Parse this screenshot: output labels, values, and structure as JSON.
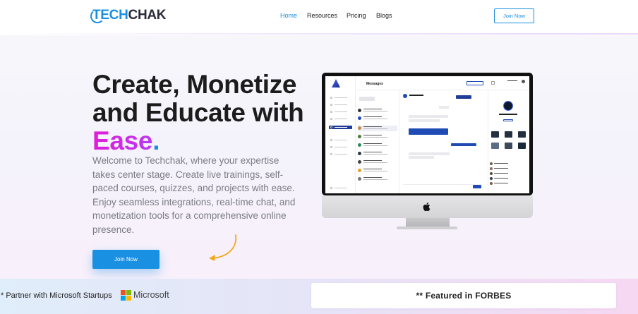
{
  "brand": {
    "part1": "TECH",
    "part2": "CHAK"
  },
  "nav": {
    "links": [
      {
        "label": "Home",
        "active": true
      },
      {
        "label": "Resources",
        "active": false
      },
      {
        "label": "Pricing",
        "active": false
      },
      {
        "label": "Blogs",
        "active": false
      }
    ],
    "join_label": "Join Now"
  },
  "hero": {
    "headline_line1": "Create, Monetize",
    "headline_line2": "and Educate with",
    "headline_ease": "Ease",
    "headline_dot": ".",
    "subtext": "Welcome to Techchak, where your expertise takes center stage. Create live trainings, self-paced courses, quizzes, and projects with ease. Enjoy seamless integrations, real-time chat, and monetization tools for a comprehensive online presence.",
    "join_label": "Join Now"
  },
  "screen": {
    "title": "Messages"
  },
  "partners": {
    "microsoft_text": "* Partner with Microsoft Startups",
    "microsoft_logo_text": "Microsoft",
    "featured_text": "** Featured in FORBES"
  },
  "colors": {
    "accent": "#1a8fe0",
    "ease_gradient_start": "#e01cdb",
    "ease_gradient_end": "#b93af0",
    "dark_text": "#1c1c1c",
    "muted_text": "#7b7b85"
  },
  "icons": [
    "techchak-logo-icon",
    "apple-icon",
    "microsoft-logo-icon",
    "curved-arrow-icon"
  ]
}
